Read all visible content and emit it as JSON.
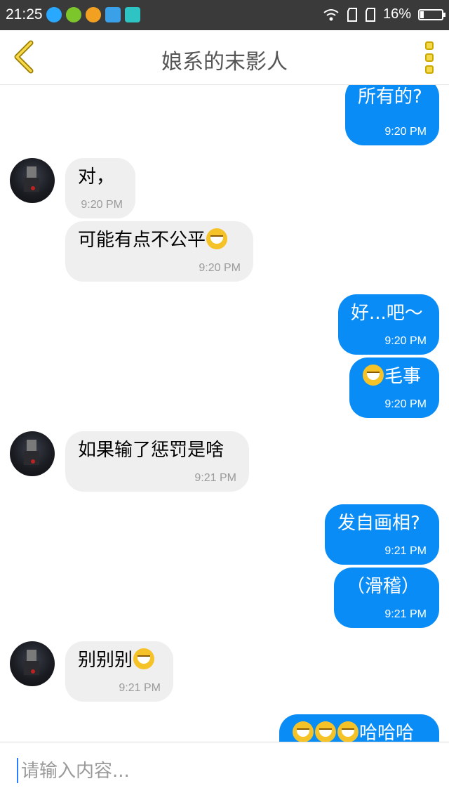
{
  "status_bar": {
    "time": "21:25",
    "app_icons": [
      {
        "icon": "qq-icon",
        "color": "#29a8ff"
      },
      {
        "icon": "add-app-icon",
        "color": "#7cc52b"
      },
      {
        "icon": "cloud-app-icon",
        "color": "#f2a021"
      },
      {
        "icon": "gallery-app-icon",
        "color": "#3aa0e8"
      },
      {
        "icon": "scanner-app-icon",
        "color": "#2ec4c4"
      }
    ],
    "battery_text": "16%",
    "battery_level": 0.16
  },
  "header": {
    "title": "娘系的末影人",
    "back_icon": "chevron-left-icon",
    "menu_icon": "more-vertical-icon"
  },
  "messages": [
    {
      "dir": "out",
      "text": "所有的?",
      "time": "9:20 PM"
    },
    {
      "dir": "in",
      "text": "对，",
      "time": "9:20 PM"
    },
    {
      "dir": "in",
      "text": "可能有点不公平",
      "emoji_after": 1,
      "time": "9:20 PM"
    },
    {
      "dir": "out",
      "text": "好...吧～",
      "time": "9:20 PM"
    },
    {
      "dir": "out",
      "emoji_before": 1,
      "text": "毛事",
      "time": "9:20 PM"
    },
    {
      "dir": "in",
      "text": "如果输了惩罚是啥",
      "time": "9:21 PM"
    },
    {
      "dir": "out",
      "text": "发自画相?",
      "time": "9:21 PM"
    },
    {
      "dir": "out",
      "text": "（滑稽）",
      "time": "9:21 PM"
    },
    {
      "dir": "in",
      "text": "别别别",
      "emoji_after": 1,
      "time": "9:21 PM"
    },
    {
      "dir": "out",
      "emoji_before": 3,
      "text": "哈哈哈",
      "time": ""
    }
  ],
  "input": {
    "placeholder": "请输入内容..."
  },
  "colors": {
    "outgoing_bubble": "#0a8cf6",
    "incoming_bubble": "#efefef",
    "accent": "#f6d94a"
  }
}
